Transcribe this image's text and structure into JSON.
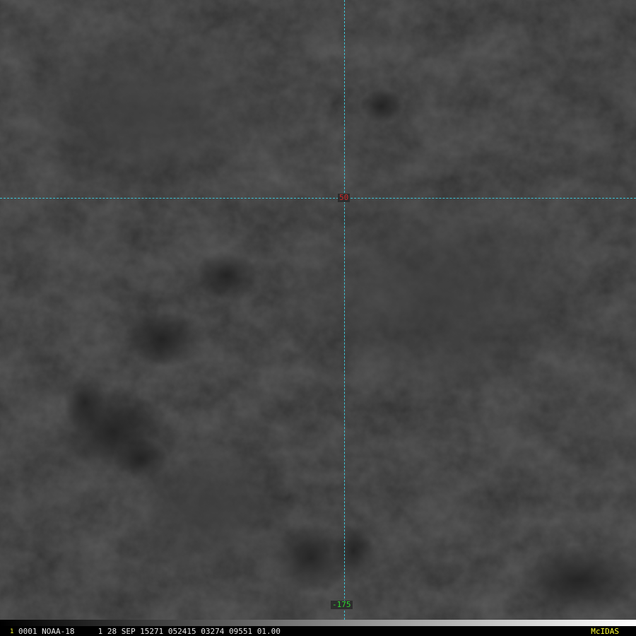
{
  "image": {
    "kind": "satellite-visible-imagery",
    "grid_color": "#3ec6d8"
  },
  "gridlines": {
    "latitude": {
      "label": "50",
      "color": "#d12a2a"
    },
    "longitude": {
      "label": "-175",
      "color": "#2fd82f"
    }
  },
  "colorbar": {
    "from_color": "#000000",
    "to_color": "#ffffff"
  },
  "status_bar": {
    "frame_number": "1",
    "frame_number_color": "#ffff33",
    "text": "0001 NOAA-18     1 28 SEP 15271 052415 03274 09551 01.00",
    "text_color": "#e8e8e8",
    "brand": "McIDAS",
    "brand_color": "#ffff33"
  }
}
